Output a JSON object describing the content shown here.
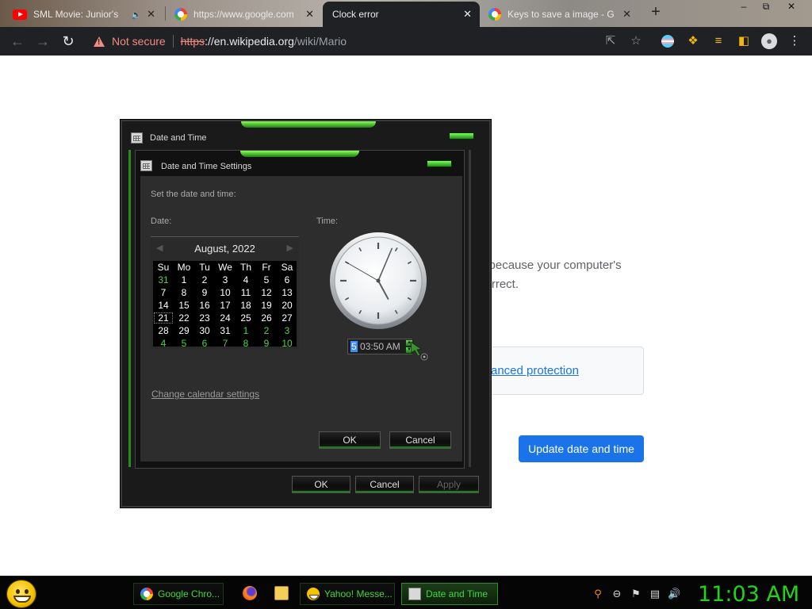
{
  "browser": {
    "tabs": [
      {
        "title": "SML Movie: Junior's",
        "icon": "youtube-icon",
        "audio": true
      },
      {
        "title": "https://www.google.com",
        "icon": "google-icon"
      },
      {
        "title": "Clock error",
        "icon": "none",
        "active": true
      },
      {
        "title": "Keys to save a image - G",
        "icon": "google-icon"
      }
    ],
    "new_tab": "+",
    "window_controls": {
      "minimize": "–",
      "restore": "⧉",
      "close": "✕"
    },
    "address": {
      "security_label": "Not secure",
      "scheme": "https",
      "separator": "://",
      "host": "en.wikipedia.org",
      "path": "/wiki/Mario"
    }
  },
  "page": {
    "message_line1": "d because your computer's",
    "message_line2": "correct.",
    "protection_link": "anced protection",
    "update_button": "Update date and time",
    "accent": "#1a73e8"
  },
  "outer_dialog": {
    "title": "Date and Time",
    "buttons": {
      "ok": "OK",
      "cancel": "Cancel",
      "apply": "Apply"
    }
  },
  "inner_dialog": {
    "title": "Date and Time Settings",
    "instruction": "Set the date and time:",
    "date_label": "Date:",
    "time_label": "Time:",
    "calendar": {
      "month_year": "August, 2022",
      "prev": "◀",
      "next": "▶",
      "weekdays": [
        "Su",
        "Mo",
        "Tu",
        "We",
        "Th",
        "Fr",
        "Sa"
      ],
      "weeks": [
        [
          "31",
          "1",
          "2",
          "3",
          "4",
          "5",
          "6"
        ],
        [
          "7",
          "8",
          "9",
          "10",
          "11",
          "12",
          "13"
        ],
        [
          "14",
          "15",
          "16",
          "17",
          "18",
          "19",
          "20"
        ],
        [
          "21",
          "22",
          "23",
          "24",
          "25",
          "26",
          "27"
        ],
        [
          "28",
          "29",
          "30",
          "31",
          "1",
          "2",
          "3"
        ],
        [
          "4",
          "5",
          "6",
          "7",
          "8",
          "9",
          "10"
        ]
      ],
      "other_month": [
        [
          0,
          0
        ],
        [
          4,
          4
        ],
        [
          4,
          5
        ],
        [
          4,
          6
        ],
        [
          5,
          0
        ],
        [
          5,
          1
        ],
        [
          5,
          2
        ],
        [
          5,
          3
        ],
        [
          5,
          4
        ],
        [
          5,
          5
        ],
        [
          5,
          6
        ]
      ],
      "selected": [
        3,
        0
      ]
    },
    "time": {
      "hour": "5",
      "rest": " 03:50 AM",
      "clock_hour": 5,
      "clock_minute": 3,
      "clock_second": 50
    },
    "change_calendar_link": "Change calendar settings",
    "buttons": {
      "ok": "OK",
      "cancel": "Cancel"
    }
  },
  "taskbar": {
    "tasks": [
      {
        "label": "Google Chro...",
        "icon": "chrome-icon"
      },
      {
        "label": "Yahoo! Messe...",
        "icon": "yahoo-icon"
      },
      {
        "label": "Date and Time",
        "icon": "datetime-icon",
        "active": true
      }
    ],
    "quick_launch": [
      "firefox-icon",
      "folder-icon"
    ],
    "tray_icons": [
      "search-icon",
      "minus-circle-icon",
      "action-center-flag-icon",
      "network-icon",
      "volume-icon"
    ],
    "clock": "11:03 AM",
    "clock_color": "#1fd41a"
  }
}
